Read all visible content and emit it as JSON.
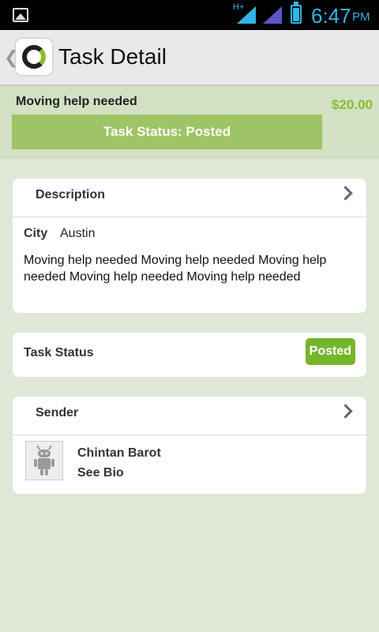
{
  "status_bar": {
    "network_label": "H+",
    "time": "6:47",
    "ampm": "PM",
    "accent_color": "#33b5e5",
    "icons": [
      "image-notification-icon",
      "signal-icon",
      "battery-icon"
    ]
  },
  "action_bar": {
    "title": "Task Detail",
    "back_icon": "chevron-left-icon",
    "logo_icon": "app-logo-icon"
  },
  "task": {
    "title": "Moving help needed",
    "price": "$20.00",
    "status_banner": "Task Status: Posted",
    "price_color": "#8bbd2c",
    "banner_color": "#9ec465"
  },
  "description_card": {
    "heading": "Description",
    "city_label": "City",
    "city_value": "Austin",
    "text": "Moving help needed Moving help needed Moving help needed Moving help needed Moving help needed"
  },
  "status_card": {
    "label": "Task Status",
    "badge": "Posted",
    "badge_color": "#76b62b"
  },
  "sender_card": {
    "heading": "Sender",
    "name": "Chintan Barot",
    "link": "See Bio",
    "avatar_icon": "android-robot-icon"
  }
}
